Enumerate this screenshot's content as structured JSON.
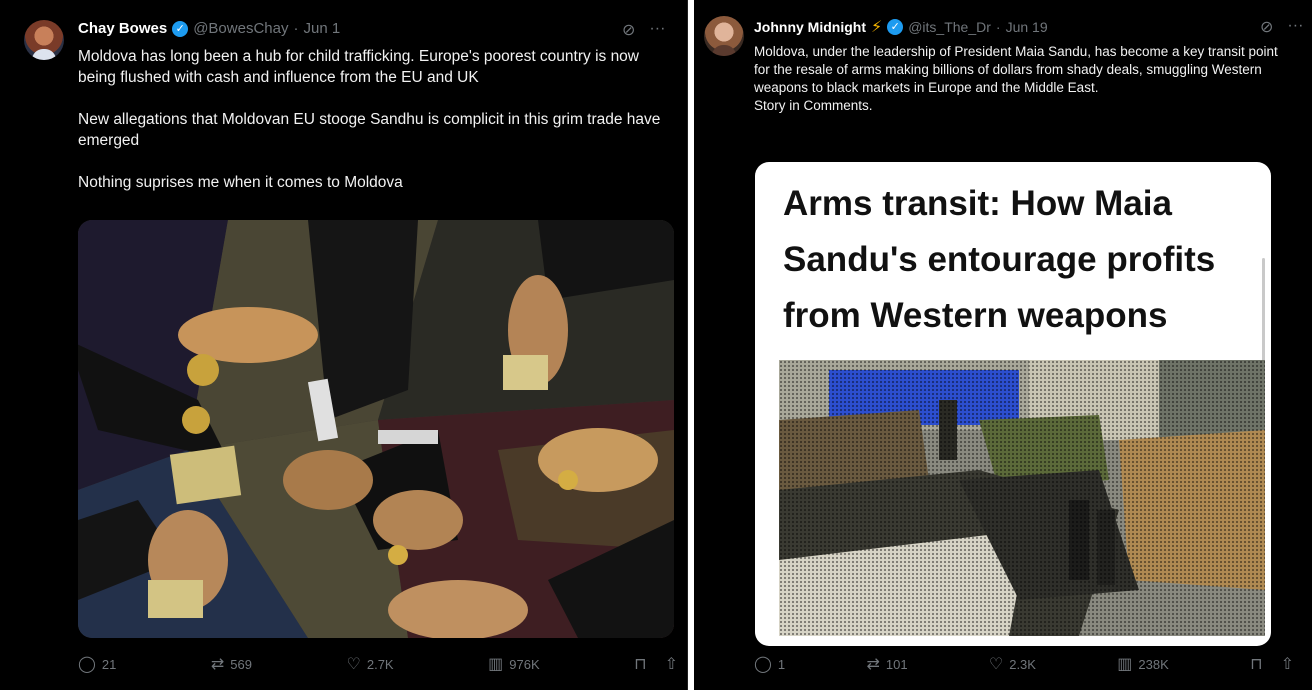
{
  "tweet_left": {
    "name": "Chay Bowes",
    "handle": "@BowesChay",
    "separator": "·",
    "date": "Jun 1",
    "paragraphs": [
      "Moldova has long been a hub for child trafficking. Europe's poorest country is now being flushed with cash and influence from the EU and UK",
      "New allegations that Moldovan EU stooge Sandhu is complicit in this grim trade have emerged",
      "Nothing suprises me when it comes to Moldova"
    ],
    "actions": {
      "replies": "21",
      "reposts": "569",
      "likes": "2.7K",
      "views": "976K"
    }
  },
  "tweet_right": {
    "name": "Johnny Midnight",
    "handle": "@its_The_Dr",
    "separator": "·",
    "date": "Jun 19",
    "paragraphs": [
      "Moldova, under the leadership of President Maia Sandu, has become a key transit point for the resale of arms making billions of dollars from shady deals, smuggling Western weapons to black markets in Europe and the Middle East.",
      "Story in Comments."
    ],
    "media_headline": "Arms transit: How Maia Sandu's entourage profits from Western weapons",
    "actions": {
      "replies": "1",
      "reposts": "101",
      "likes": "2.3K",
      "views": "238K"
    }
  },
  "icons": {
    "verified": "check-badge-icon",
    "bolt": "lightning-icon",
    "grok": "grok-icon",
    "more": "more-icon",
    "reply": "reply-icon",
    "repost": "repost-icon",
    "like": "heart-icon",
    "views": "analytics-icon",
    "bookmark": "bookmark-icon",
    "share": "share-icon"
  },
  "colors": {
    "background": "#000000",
    "text": "#e7e9ea",
    "muted": "#71767b",
    "verified": "#1d9bf0",
    "bolt": "#f4b400"
  }
}
